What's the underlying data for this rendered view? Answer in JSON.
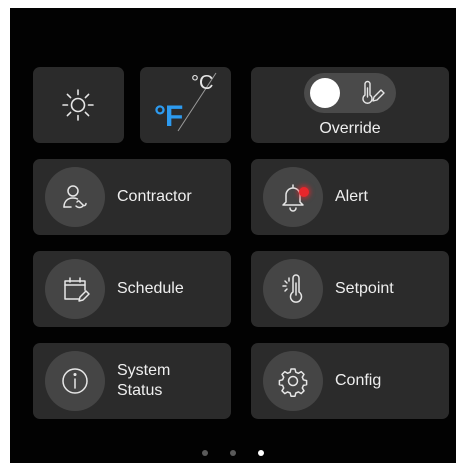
{
  "units": {
    "fahrenheit": "°F",
    "celsius": "°C",
    "active": "fahrenheit"
  },
  "override": {
    "label": "Override",
    "toggle_on": false
  },
  "tiles": {
    "contractor": {
      "label": "Contractor",
      "icon": "contractor-icon"
    },
    "alert": {
      "label": "Alert",
      "icon": "bell-icon",
      "badge_color": "#e8262b"
    },
    "schedule": {
      "label": "Schedule",
      "icon": "calendar-edit-icon"
    },
    "setpoint": {
      "label": "Setpoint",
      "icon": "thermometer-icon"
    },
    "system_status": {
      "label_line1": "System",
      "label_line2": "Status",
      "icon": "info-icon"
    },
    "config": {
      "label": "Config",
      "icon": "gear-icon"
    }
  },
  "pagination": {
    "pages": 3,
    "active_page": 3
  },
  "colors": {
    "accent": "#2d9bf0",
    "tile": "#2b2b2b",
    "icon_circle": "#454545",
    "background": "#020202",
    "alert": "#e8262b"
  }
}
